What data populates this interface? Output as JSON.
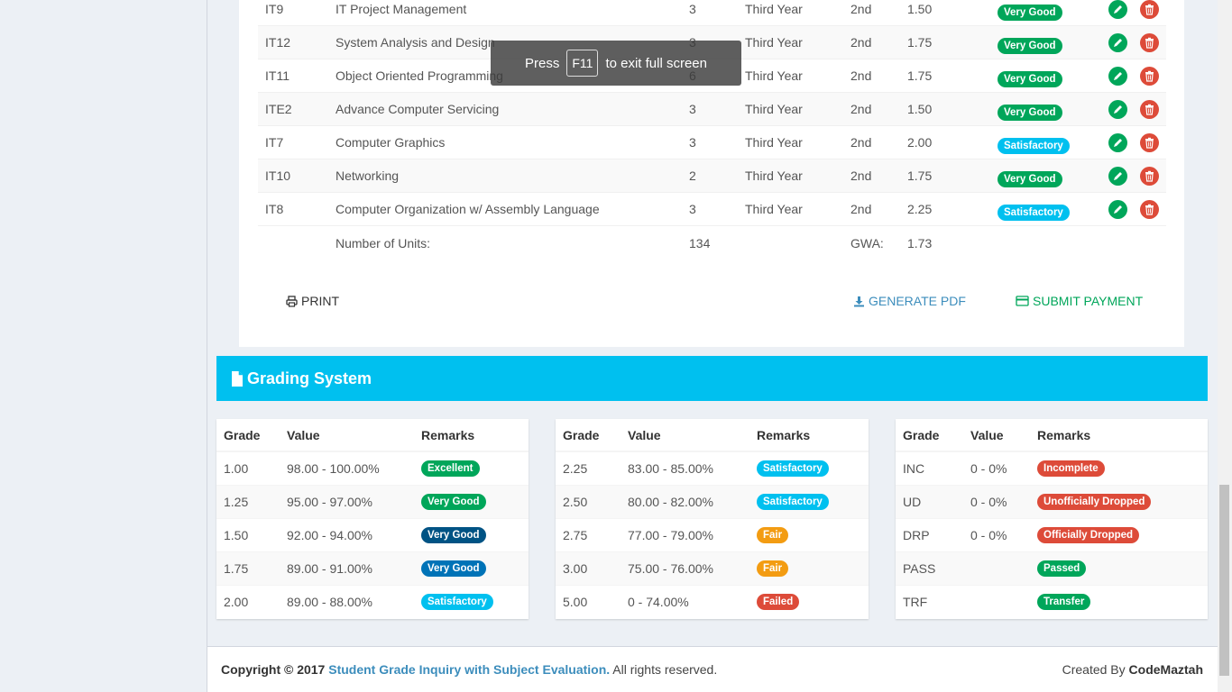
{
  "subjects": [
    {
      "code": "IT9",
      "description": "IT Project Management",
      "units": "3",
      "year": "Third Year",
      "sem": "2nd",
      "grade": "1.50",
      "remark": "Very Good",
      "remark_color": "#00a65a"
    },
    {
      "code": "IT12",
      "description": "System Analysis and Design",
      "units": "3",
      "year": "Third Year",
      "sem": "2nd",
      "grade": "1.75",
      "remark": "Very Good",
      "remark_color": "#00a65a"
    },
    {
      "code": "IT11",
      "description": "Object Oriented Programming",
      "units": "6",
      "year": "Third Year",
      "sem": "2nd",
      "grade": "1.75",
      "remark": "Very Good",
      "remark_color": "#00a65a"
    },
    {
      "code": "ITE2",
      "description": "Advance Computer Servicing",
      "units": "3",
      "year": "Third Year",
      "sem": "2nd",
      "grade": "1.50",
      "remark": "Very Good",
      "remark_color": "#00a65a"
    },
    {
      "code": "IT7",
      "description": "Computer Graphics",
      "units": "3",
      "year": "Third Year",
      "sem": "2nd",
      "grade": "2.00",
      "remark": "Satisfactory",
      "remark_color": "#00c0ef"
    },
    {
      "code": "IT10",
      "description": "Networking",
      "units": "2",
      "year": "Third Year",
      "sem": "2nd",
      "grade": "1.75",
      "remark": "Very Good",
      "remark_color": "#00a65a"
    },
    {
      "code": "IT8",
      "description": "Computer Organization w/ Assembly Language",
      "units": "3",
      "year": "Third Year",
      "sem": "2nd",
      "grade": "2.25",
      "remark": "Satisfactory",
      "remark_color": "#00c0ef"
    }
  ],
  "summary": {
    "units_label": "Number of Units:",
    "units_value": "134",
    "gwa_label": "GWA:",
    "gwa_value": "1.73"
  },
  "actions": {
    "print": "PRINT",
    "generate_pdf": "GENERATE PDF",
    "submit_payment": "SUBMIT PAYMENT"
  },
  "fullscreen_notice": {
    "before": "Press",
    "key": "F11",
    "after": "to exit full screen"
  },
  "grading_system": {
    "title": "Grading System",
    "headers": {
      "grade": "Grade",
      "value": "Value",
      "remarks": "Remarks"
    },
    "tables": [
      [
        {
          "grade": "1.00",
          "value": "98.00 - 100.00%",
          "remark": "Excellent",
          "color": "#00a65a"
        },
        {
          "grade": "1.25",
          "value": "95.00 - 97.00%",
          "remark": "Very Good",
          "color": "#00a65a"
        },
        {
          "grade": "1.50",
          "value": "92.00 - 94.00%",
          "remark": "Very Good",
          "color": "#005384"
        },
        {
          "grade": "1.75",
          "value": "89.00 - 91.00%",
          "remark": "Very Good",
          "color": "#0073b7"
        },
        {
          "grade": "2.00",
          "value": "89.00 - 88.00%",
          "remark": "Satisfactory",
          "color": "#00c0ef"
        }
      ],
      [
        {
          "grade": "2.25",
          "value": "83.00 - 85.00%",
          "remark": "Satisfactory",
          "color": "#00c0ef"
        },
        {
          "grade": "2.50",
          "value": "80.00 - 82.00%",
          "remark": "Satisfactory",
          "color": "#00c0ef"
        },
        {
          "grade": "2.75",
          "value": "77.00 - 79.00%",
          "remark": "Fair",
          "color": "#f39c12"
        },
        {
          "grade": "3.00",
          "value": "75.00 - 76.00%",
          "remark": "Fair",
          "color": "#f39c12"
        },
        {
          "grade": "5.00",
          "value": "0 - 74.00%",
          "remark": "Failed",
          "color": "#dd4b39"
        }
      ],
      [
        {
          "grade": "INC",
          "value": "0 - 0%",
          "remark": "Incomplete",
          "color": "#dd4b39"
        },
        {
          "grade": "UD",
          "value": "0 - 0%",
          "remark": "Unofficially Dropped",
          "color": "#dd4b39"
        },
        {
          "grade": "DRP",
          "value": "0 - 0%",
          "remark": "Officially Dropped",
          "color": "#dd4b39"
        },
        {
          "grade": "PASS",
          "value": "",
          "remark": "Passed",
          "color": "#00a65a"
        },
        {
          "grade": "TRF",
          "value": "",
          "remark": "Transfer",
          "color": "#00a65a"
        }
      ]
    ]
  },
  "footer": {
    "copyright": "Copyright © 2017",
    "app_name": "Student Grade Inquiry with Subject Evaluation.",
    "rights": "All rights reserved.",
    "created_by": "Created By",
    "author": "CodeMaztah"
  },
  "colors": {
    "accent": "#00c0ef",
    "success": "#00a65a",
    "danger": "#dd4b39",
    "warning": "#f39c12",
    "primary": "#3c8dbc"
  }
}
